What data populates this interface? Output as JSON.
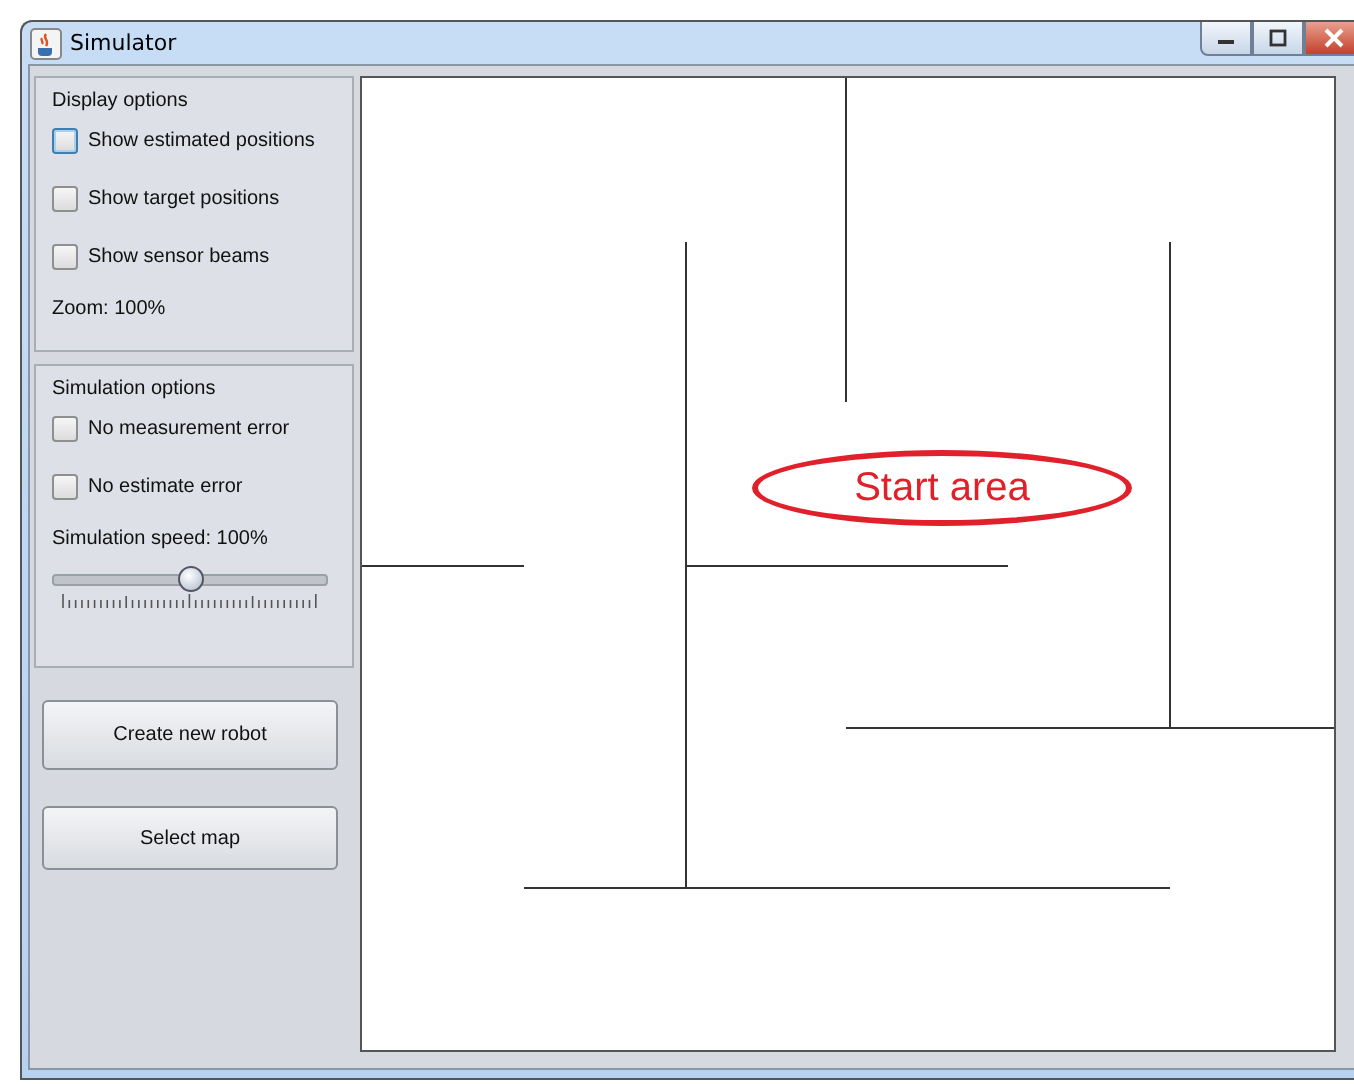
{
  "window": {
    "title": "Simulator"
  },
  "display_options": {
    "title": "Display options",
    "checkboxes": [
      {
        "label": "Show estimated positions",
        "checked": false,
        "focused": true
      },
      {
        "label": "Show target positions",
        "checked": false,
        "focused": false
      },
      {
        "label": "Show sensor beams",
        "checked": false,
        "focused": false
      }
    ],
    "zoom": "Zoom:  100%"
  },
  "simulation_options": {
    "title": "Simulation options",
    "checkboxes": [
      {
        "label": "No measurement error",
        "checked": false,
        "focused": false
      },
      {
        "label": "No estimate error",
        "checked": false,
        "focused": false
      }
    ],
    "speed_label": "Simulation speed:  100%",
    "speed_slider": {
      "level": 0.5
    }
  },
  "buttons": [
    "Create new robot",
    "Select map"
  ],
  "map": {
    "annotation": "Start area"
  }
}
